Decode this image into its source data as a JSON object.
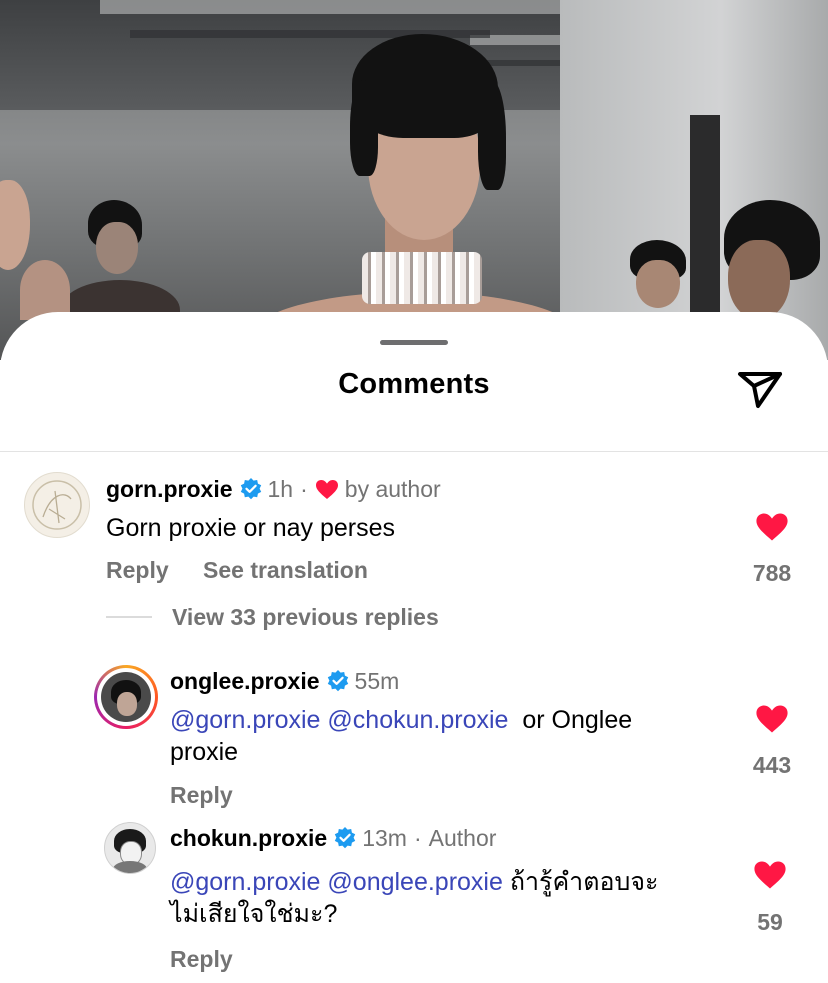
{
  "sheet": {
    "title": "Comments",
    "icons": {
      "share": "send-icon",
      "grabber": "drag-handle"
    }
  },
  "colors": {
    "heart": "#ff1744",
    "verified": "#1d9bf0",
    "mention": "#3a46b8",
    "meta": "#737373"
  },
  "comments": [
    {
      "username": "gorn.proxie",
      "verified": true,
      "time": "1h",
      "separator": "·",
      "liked_by_author": "by author",
      "text": "Gorn proxie or nay perses",
      "reply_label": "Reply",
      "translate_label": "See translation",
      "likes": "788"
    }
  ],
  "view_replies": "View 33 previous replies",
  "replies": [
    {
      "username": "onglee.proxie",
      "verified": true,
      "time": "55m",
      "mentions": [
        "@gorn.proxie",
        "@chokun.proxie"
      ],
      "text_line1": "or Onglee",
      "text_line2": "proxie",
      "reply_label": "Reply",
      "likes": "443"
    },
    {
      "username": "chokun.proxie",
      "verified": true,
      "time": "13m",
      "separator": "·",
      "tag": "Author",
      "mentions": [
        "@gorn.proxie",
        "@onglee.proxie"
      ],
      "text_line1": "ถ้ารู้คำตอบจะ",
      "text_line2": "ไม่เสียใจใช่มะ?",
      "reply_label": "Reply",
      "likes": "59"
    }
  ]
}
